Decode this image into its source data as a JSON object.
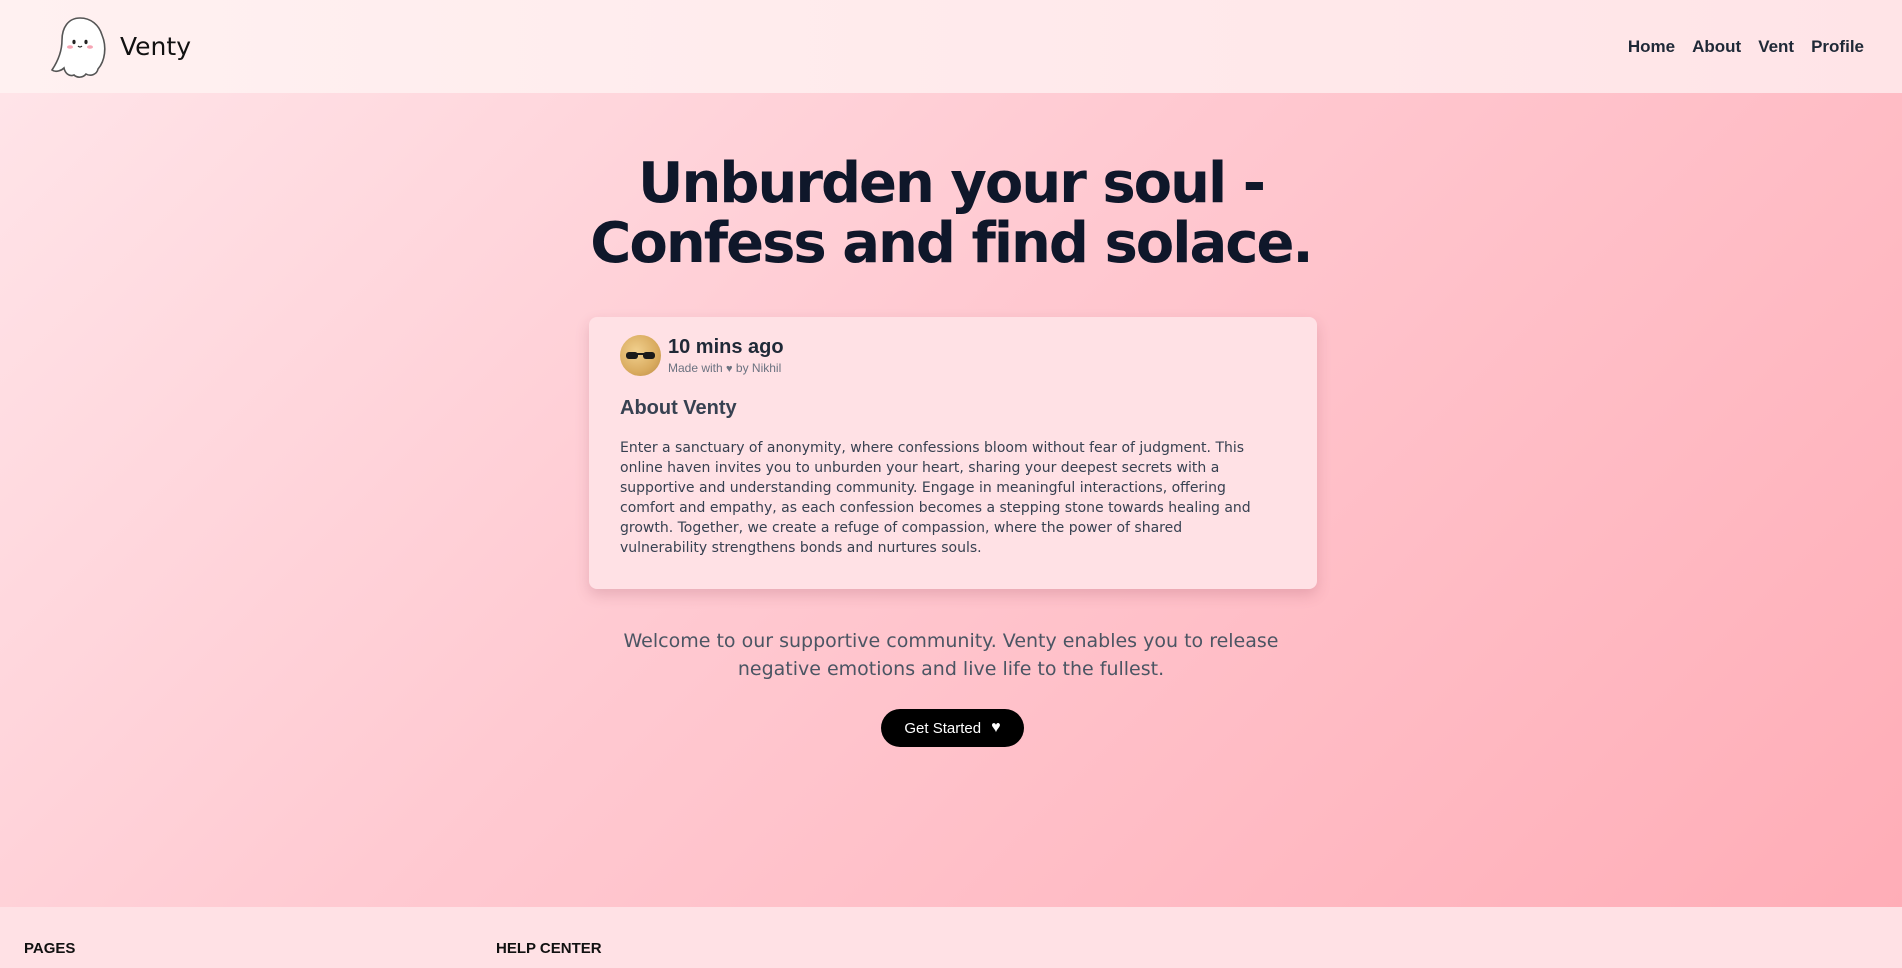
{
  "navbar": {
    "brand": "Venty",
    "links": [
      "Home",
      "About",
      "Vent",
      "Profile"
    ]
  },
  "hero": {
    "title_line1": "Unburden your soul -",
    "title_line2": "Confess and find solace."
  },
  "card": {
    "time": "10 mins ago",
    "made_with_prefix": "Made with",
    "made_with_suffix": "by Nikhil",
    "title": "About Venty",
    "body": "Enter a sanctuary of anonymity, where confessions bloom without fear of judgment. This online haven invites you to unburden your heart, sharing your deepest secrets with a supportive and understanding community. Engage in meaningful interactions, offering comfort and empathy, as each confession becomes a stepping stone towards healing and growth. Together, we create a refuge of compassion, where the power of shared vulnerability strengthens bonds and nurtures souls."
  },
  "welcome": "Welcome to our supportive community. Venty enables you to release negative emotions and live life to the fullest.",
  "cta": {
    "label": "Get Started",
    "icon": "heart-icon"
  },
  "footer": {
    "col1": "PAGES",
    "col2": "HELP CENTER"
  },
  "colors": {
    "accent": "#000000",
    "background": "#ffc9d1",
    "heading": "#0f172a"
  }
}
